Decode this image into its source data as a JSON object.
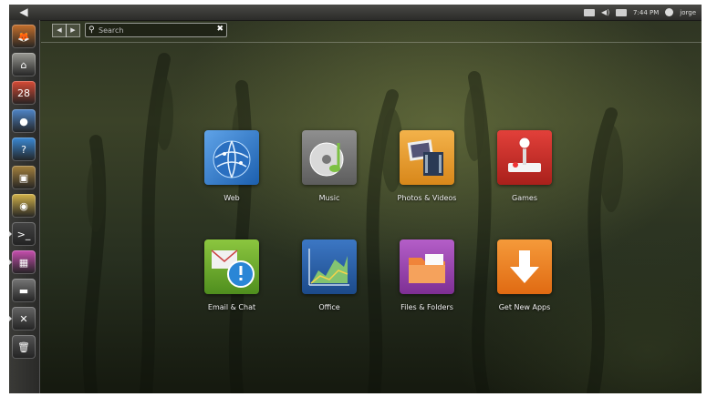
{
  "top_panel": {
    "ubuntu_glyph": "◀",
    "time": "7:44 PM",
    "user": "jorge",
    "indicators": [
      "battery-icon",
      "sound-icon",
      "mail-icon",
      "user-icon"
    ]
  },
  "launcher": {
    "items": [
      {
        "name": "firefox-icon",
        "color": "#c8702c",
        "glyph": "🦊"
      },
      {
        "name": "home-folder-icon",
        "color": "#9b9b95",
        "glyph": "⌂"
      },
      {
        "name": "calendar-icon",
        "color": "#d84b36",
        "glyph": "28"
      },
      {
        "name": "chat-icon",
        "color": "#4f86c9",
        "glyph": "●"
      },
      {
        "name": "help-icon",
        "color": "#3a8ad6",
        "glyph": "?"
      },
      {
        "name": "software-center-icon",
        "color": "#a6823e",
        "glyph": "▣"
      },
      {
        "name": "rhythmbox-icon",
        "color": "#d4b44a",
        "glyph": "◉"
      },
      {
        "name": "terminal-icon",
        "color": "#444",
        "glyph": ">_"
      },
      {
        "name": "media-icon",
        "color": "#c84fb0",
        "glyph": "▦"
      },
      {
        "name": "workspace-icon",
        "color": "#777",
        "glyph": "▬"
      },
      {
        "name": "settings-icon",
        "color": "#666",
        "glyph": "✕"
      },
      {
        "name": "trash-icon",
        "color": "#555",
        "glyph": "🗑"
      }
    ]
  },
  "dash": {
    "search_placeholder": "Search",
    "back_glyph": "◀",
    "forward_glyph": "▶",
    "clear_glyph": "✖"
  },
  "apps": [
    {
      "label": "Web",
      "icon": "web-icon"
    },
    {
      "label": "Music",
      "icon": "music-icon"
    },
    {
      "label": "Photos & Videos",
      "icon": "photos-videos-icon"
    },
    {
      "label": "Games",
      "icon": "games-icon"
    },
    {
      "label": "Email & Chat",
      "icon": "email-chat-icon"
    },
    {
      "label": "Office",
      "icon": "office-icon"
    },
    {
      "label": "Files & Folders",
      "icon": "files-folders-icon"
    },
    {
      "label": "Get New Apps",
      "icon": "get-new-apps-icon"
    }
  ]
}
